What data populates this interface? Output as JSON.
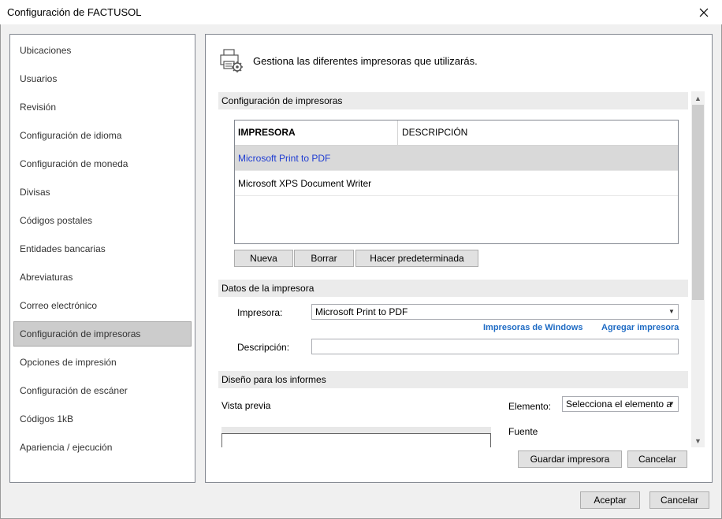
{
  "window": {
    "title": "Configuración de FACTUSOL"
  },
  "sidebar": {
    "items": [
      {
        "label": "Ubicaciones"
      },
      {
        "label": "Usuarios"
      },
      {
        "label": "Revisión"
      },
      {
        "label": "Configuración de idioma"
      },
      {
        "label": "Configuración de moneda"
      },
      {
        "label": "Divisas"
      },
      {
        "label": "Códigos postales"
      },
      {
        "label": "Entidades bancarias"
      },
      {
        "label": "Abreviaturas"
      },
      {
        "label": "Correo electrónico"
      },
      {
        "label": "Configuración de impresoras",
        "active": true
      },
      {
        "label": "Opciones de impresión"
      },
      {
        "label": "Configuración de escáner"
      },
      {
        "label": "Códigos 1kB"
      },
      {
        "label": "Apariencia / ejecución"
      }
    ]
  },
  "panel": {
    "header_text": "Gestiona las diferentes impresoras que utilizarás.",
    "printers_section": {
      "title": "Configuración de impresoras",
      "columns": [
        "IMPRESORA",
        "DESCRIPCIÓN"
      ],
      "rows": [
        {
          "name": "Microsoft Print to PDF",
          "description": "",
          "selected": true
        },
        {
          "name": "Microsoft XPS Document Writer",
          "description": ""
        }
      ],
      "buttons": {
        "new": "Nueva",
        "delete": "Borrar",
        "set_default": "Hacer predeterminada"
      }
    },
    "printer_data_section": {
      "title": "Datos de la impresora",
      "printer_label": "Impresora:",
      "printer_value": "Microsoft Print to PDF",
      "windows_printers_link": "Impresoras de Windows",
      "add_printer_link": "Agregar impresora",
      "description_label": "Descripción:",
      "description_value": ""
    },
    "report_design_section": {
      "title": "Diseño para los informes",
      "preview_label": "Vista previa",
      "element_label": "Elemento:",
      "element_value": "Selecciona el elemento a",
      "font_label": "Fuente"
    },
    "save_printer_button": "Guardar impresora",
    "cancel_button": "Cancelar"
  },
  "footer": {
    "accept": "Aceptar",
    "cancel": "Cancelar"
  }
}
